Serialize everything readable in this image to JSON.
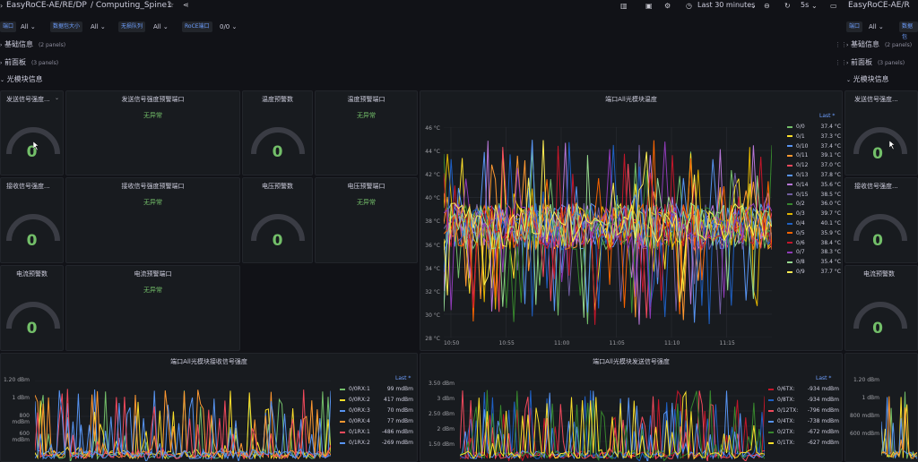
{
  "topbar": {
    "breadcrumb": "EasyRoCE-AE/RE/DP",
    "dashboard": "/ Computing_Spine1",
    "breadcrumb_right": "EasyRoCE-AE/R",
    "time_range": "Last 30 minutes",
    "refresh": "5s"
  },
  "variables": [
    {
      "label": "端口",
      "value": "All"
    },
    {
      "label": "数据包大小",
      "value": "All"
    },
    {
      "label": "无损队列",
      "value": "All"
    },
    {
      "label": "RoCE端口",
      "value": "0/0"
    }
  ],
  "variables_right": [
    {
      "label": "端口",
      "value": "All"
    },
    {
      "label": "数据包"
    }
  ],
  "rows": [
    {
      "title": "基础信息",
      "sub": "(2 panels)"
    },
    {
      "title": "前面板",
      "sub": "(3 panels)"
    },
    {
      "title": "光模块信息"
    }
  ],
  "stats": {
    "ok_text": "无异常",
    "send_strength": {
      "title": "发送信号强度...",
      "value": "0"
    },
    "send_warn": {
      "title": "发送信号强度预警端口"
    },
    "temp_count": {
      "title": "温度预警数",
      "value": "0"
    },
    "temp_port": {
      "title": "温度预警端口"
    },
    "recv_strength": {
      "title": "接收信号强度...",
      "value": "0"
    },
    "recv_warn": {
      "title": "接收信号强度预警端口"
    },
    "volt_count": {
      "title": "电压预警数",
      "value": "0"
    },
    "volt_port": {
      "title": "电压预警端口"
    },
    "curr_count": {
      "title": "电流预警数",
      "value": "0"
    },
    "curr_port": {
      "title": "电流预警端口"
    },
    "right_send": {
      "title": "发送信号强度...",
      "value": "0"
    },
    "right_recv": {
      "title": "接收信号强度...",
      "value": "0"
    },
    "right_curr": {
      "title": "电流预警数",
      "value": "0"
    }
  },
  "temp_chart": {
    "title": "端口All光模块温度",
    "legend_header": "Last *",
    "yticks": [
      "46 °C",
      "44 °C",
      "42 °C",
      "40 °C",
      "38 °C",
      "36 °C",
      "34 °C",
      "32 °C",
      "30 °C",
      "28 °C"
    ],
    "xticks": [
      "10:50",
      "10:55",
      "11:00",
      "11:05",
      "11:10",
      "11:15"
    ]
  },
  "rx_chart": {
    "title": "端口All光模块接收信号强度",
    "legend_header": "Last *",
    "yticks": [
      "1.20 dBm",
      "1 dBm",
      "800 mdBm",
      "600 mdBm"
    ]
  },
  "tx_chart": {
    "title": "端口All光模块发送信号强度",
    "legend_header": "Last *",
    "yticks": [
      "3.50 dBm",
      "3 dBm",
      "2.50 dBm",
      "2 dBm",
      "1.50 dBm"
    ]
  },
  "right_chart": {
    "yticks": [
      "1.20 dBm",
      "1 dBm",
      "800 mdBm",
      "600 mdBm"
    ]
  },
  "chart_data": [
    {
      "type": "line",
      "title": "端口All光模块温度",
      "ylim": [
        28,
        46
      ],
      "unit": "°C",
      "series": [
        {
          "name": "0/0",
          "last": "37.4 °C",
          "color": "#73bf69"
        },
        {
          "name": "0/1",
          "last": "37.3 °C",
          "color": "#fade2a"
        },
        {
          "name": "0/10",
          "last": "37.4 °C",
          "color": "#5794f2"
        },
        {
          "name": "0/11",
          "last": "39.1 °C",
          "color": "#ff9830"
        },
        {
          "name": "0/12",
          "last": "37.0 °C",
          "color": "#f2495c"
        },
        {
          "name": "0/13",
          "last": "37.8 °C",
          "color": "#5794f2"
        },
        {
          "name": "0/14",
          "last": "35.6 °C",
          "color": "#b877d9"
        },
        {
          "name": "0/15",
          "last": "38.5 °C",
          "color": "#705da0"
        },
        {
          "name": "0/2",
          "last": "36.0 °C",
          "color": "#37872d"
        },
        {
          "name": "0/3",
          "last": "39.7 °C",
          "color": "#e0b400"
        },
        {
          "name": "0/4",
          "last": "40.1 °C",
          "color": "#1f60c4"
        },
        {
          "name": "0/5",
          "last": "35.9 °C",
          "color": "#fa6400"
        },
        {
          "name": "0/6",
          "last": "38.4 °C",
          "color": "#c4162a"
        },
        {
          "name": "0/7",
          "last": "38.3 °C",
          "color": "#8f3bb8"
        },
        {
          "name": "0/8",
          "last": "35.4 °C",
          "color": "#96d98d"
        },
        {
          "name": "0/9",
          "last": "37.7 °C",
          "color": "#ffee52"
        }
      ]
    },
    {
      "type": "line",
      "title": "端口All光模块接收信号强度",
      "series": [
        {
          "name": "0/0RX:1",
          "last": "99 mdBm",
          "color": "#73bf69"
        },
        {
          "name": "0/0RX:2",
          "last": "417 mdBm",
          "color": "#fade2a"
        },
        {
          "name": "0/0RX:3",
          "last": "70 mdBm",
          "color": "#5794f2"
        },
        {
          "name": "0/0RX:4",
          "last": "77 mdBm",
          "color": "#ff9830"
        },
        {
          "name": "0/1RX:1",
          "last": "-486 mdBm",
          "color": "#f2495c"
        },
        {
          "name": "0/1RX:2",
          "last": "-269 mdBm",
          "color": "#5794f2"
        }
      ]
    },
    {
      "type": "line",
      "title": "端口All光模块发送信号强度",
      "series": [
        {
          "name": "0/6TX:",
          "last": "-934 mdBm",
          "color": "#c4162a"
        },
        {
          "name": "0/8TX:",
          "last": "-934 mdBm",
          "color": "#1f60c4"
        },
        {
          "name": "0/12TX:",
          "last": "-796 mdBm",
          "color": "#f2495c"
        },
        {
          "name": "0/4TX:",
          "last": "-738 mdBm",
          "color": "#5794f2"
        },
        {
          "name": "0/2TX:",
          "last": "-672 mdBm",
          "color": "#37872d"
        },
        {
          "name": "0/1TX:",
          "last": "-627 mdBm",
          "color": "#fade2a"
        }
      ]
    }
  ]
}
